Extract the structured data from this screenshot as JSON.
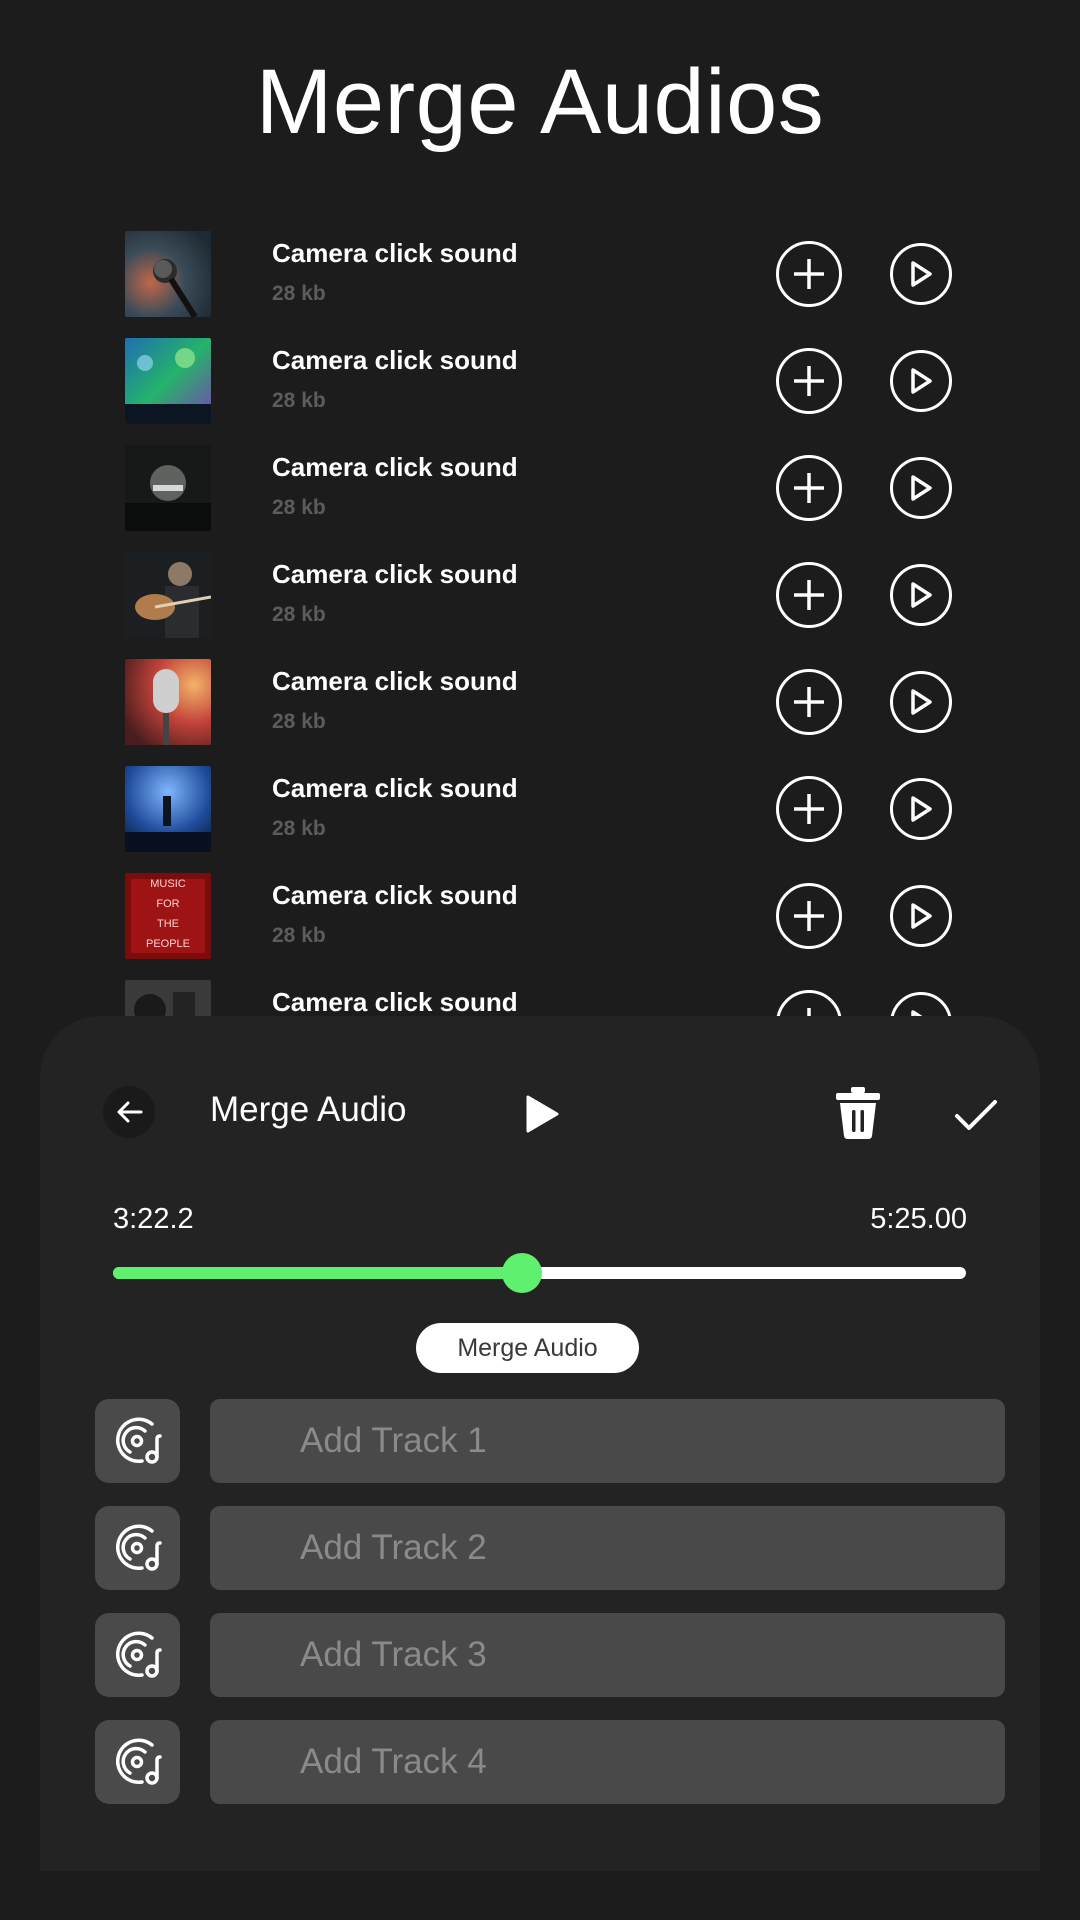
{
  "header": {
    "title": "Merge Audios"
  },
  "audio_list": [
    {
      "title": "Camera click sound",
      "size": "28 kb",
      "thumb": "microphone-photo"
    },
    {
      "title": "Camera click sound",
      "size": "28 kb",
      "thumb": "concert-lights-photo"
    },
    {
      "title": "Camera click sound",
      "size": "28 kb",
      "thumb": "stage-crowd-photo"
    },
    {
      "title": "Camera click sound",
      "size": "28 kb",
      "thumb": "guitarist-photo"
    },
    {
      "title": "Camera click sound",
      "size": "28 kb",
      "thumb": "vintage-mic-photo"
    },
    {
      "title": "Camera click sound",
      "size": "28 kb",
      "thumb": "blue-concert-photo"
    },
    {
      "title": "Camera click sound",
      "size": "28 kb",
      "thumb": "neon-sign-photo"
    },
    {
      "title": "Camera click sound",
      "size": "",
      "thumb": "speaker-photo"
    }
  ],
  "neon_sign_text": [
    "MUSIC",
    "FOR",
    "THE",
    "PEOPLE"
  ],
  "panel": {
    "title": "Merge Audio",
    "time_start": "3:22.2",
    "time_end": "5:25.00",
    "progress_fraction": 0.48,
    "merge_button": "Merge Audio",
    "tracks": [
      {
        "placeholder": "Add Track 1"
      },
      {
        "placeholder": "Add Track 2"
      },
      {
        "placeholder": "Add Track 3"
      },
      {
        "placeholder": "Add Track 4"
      }
    ]
  },
  "colors": {
    "background": "#1c1c1c",
    "panel": "#232323",
    "accent_green": "#5ff06f",
    "muted_text": "#5c5c5c",
    "track_field": "#494949"
  },
  "icons": [
    "add-circle-icon",
    "play-circle-icon",
    "arrow-left-icon",
    "play-icon",
    "trash-icon",
    "check-icon",
    "music-disc-icon"
  ]
}
